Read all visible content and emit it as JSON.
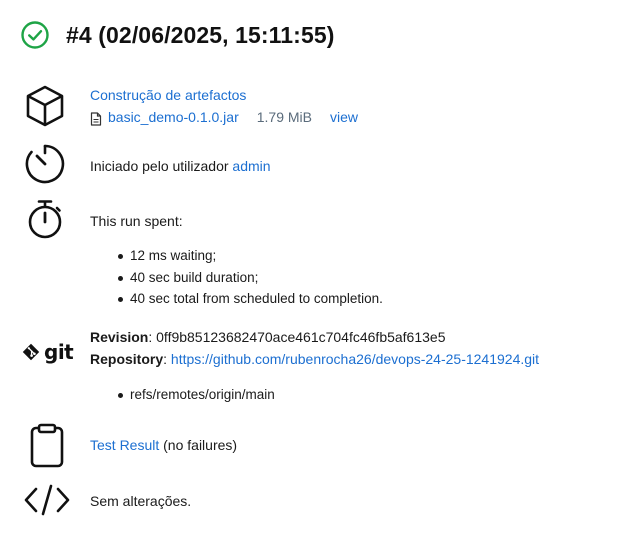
{
  "header": {
    "title": "#4 (02/06/2025, 15:11:55)",
    "status_color": "#1ea446",
    "status_icon": "check-circle-icon"
  },
  "artifacts": {
    "icon": "package-icon",
    "heading": "Construção de artefactos",
    "file": {
      "icon": "file-icon",
      "name": "basic_demo-0.1.0.jar",
      "size": "1.79 MiB",
      "view_label": "view"
    }
  },
  "started": {
    "icon": "timer-icon",
    "text": "Iniciado pelo utilizador",
    "user": "admin"
  },
  "timing": {
    "icon": "stopwatch-icon",
    "intro": "This run spent:",
    "items": [
      "12 ms waiting;",
      "40 sec build duration;",
      "40 sec total from scheduled to completion."
    ]
  },
  "git": {
    "icon": "git-logo-icon",
    "logo_text": "git",
    "revision_label": "Revision",
    "revision_value": "0ff9b85123682470ace461c704fc46fb5af613e5",
    "repository_label": "Repository",
    "repository_url": "https://github.com/rubenrocha26/devops-24-25-1241924.git",
    "refs": [
      "refs/remotes/origin/main"
    ]
  },
  "tests": {
    "icon": "clipboard-icon",
    "link": "Test Result",
    "note": "(no failures)"
  },
  "changes": {
    "icon": "code-icon",
    "text": "Sem alterações."
  },
  "colors": {
    "link": "#1c6fd1",
    "success": "#1ea446",
    "muted": "#5a6b7b"
  }
}
